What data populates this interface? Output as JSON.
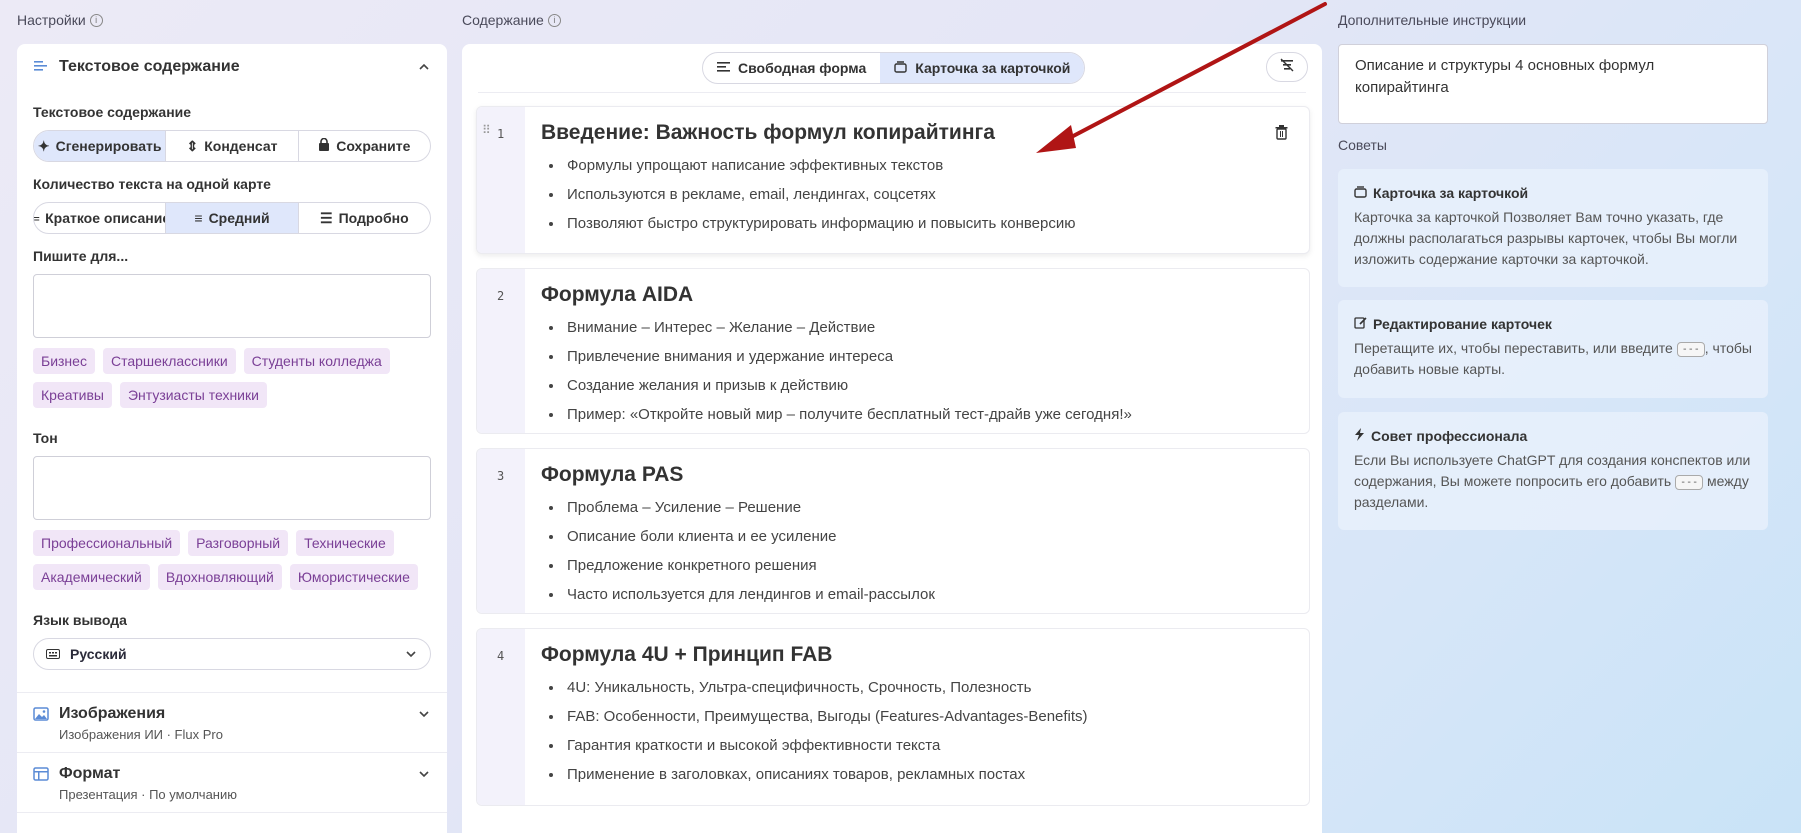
{
  "columns": {
    "settings": "Настройки",
    "content": "Содержание",
    "instructions": "Дополнительные инструкции",
    "tips": "Советы"
  },
  "left": {
    "text_section": {
      "title": "Текстовое содержание",
      "mode_label": "Текстовое содержание",
      "modes": [
        "Сгенерировать",
        "Конденсат",
        "Сохраните"
      ],
      "amount_label": "Количество текста на одной карте",
      "amounts": [
        "Краткое описание",
        "Средний",
        "Подробно"
      ],
      "write_for_label": "Пишите для...",
      "audience_chips": [
        "Бизнес",
        "Старшеклассники",
        "Студенты колледжа",
        "Креативы",
        "Энтузиасты техники"
      ],
      "tone_label": "Тон",
      "tone_chips": [
        "Профессиональный",
        "Разговорный",
        "Технические",
        "Академический",
        "Вдохновляющий",
        "Юмористические"
      ],
      "language_label": "Язык вывода",
      "language_value": "Русский"
    },
    "images_section": {
      "title": "Изображения",
      "sub": "Изображения ИИ · Flux Pro"
    },
    "format_section": {
      "title": "Формат",
      "sub": "Презентация · По умолчанию"
    }
  },
  "mid": {
    "toggle": [
      "Свободная форма",
      "Карточка за карточкой"
    ],
    "cards": [
      {
        "num": "1",
        "title": "Введение: Важность формул копирайтинга",
        "bullets": [
          "Формулы упрощают написание эффективных текстов",
          "Используются в рекламе, email, лендингах, соцсетях",
          "Позволяют быстро структурировать информацию и повысить конверсию"
        ]
      },
      {
        "num": "2",
        "title": "Формула AIDA",
        "bullets": [
          "Внимание – Интерес – Желание – Действие",
          "Привлечение внимания и удержание интереса",
          "Создание желания и призыв к действию",
          "Пример: «Откройте новый мир – получите бесплатный тест-драйв уже сегодня!»"
        ]
      },
      {
        "num": "3",
        "title": "Формула PAS",
        "bullets": [
          "Проблема – Усиление – Решение",
          "Описание боли клиента и ее усиление",
          "Предложение конкретного решения",
          "Часто используется для лендингов и email-рассылок"
        ]
      },
      {
        "num": "4",
        "title": "Формула 4U + Принцип FAB",
        "bullets": [
          "4U: Уникальность, Ультра-специфичность, Срочность, Полезность",
          "FAB: Особенности, Преимущества, Выгоды (Features-Advantages-Benefits)",
          "Гарантия краткости и высокой эффективности текста",
          "Применение в заголовках, описаниях товаров, рекламных постах"
        ]
      }
    ]
  },
  "right": {
    "instructions_value": "Описание и структуры 4 основных формул копирайтинга",
    "tips": [
      {
        "title": "Карточка за карточкой",
        "text": "Карточка за карточкой Позволяет Вам точно указать, где должны располагаться разрывы карточек, чтобы Вы могли изложить содержание карточки за карточкой."
      },
      {
        "title": "Редактирование карточек",
        "text_a": "Перетащите их, чтобы переставить, или введите",
        "kbd": "---",
        "text_b": ", чтобы добавить новые карты."
      },
      {
        "title": "Совет профессионала",
        "text_a": "Если Вы используете ChatGPT для создания конспектов или содержания, Вы можете попросить его добавить",
        "kbd": "---",
        "text_b": "между разделами."
      }
    ]
  },
  "colors": {
    "accent": "#dfe7fb",
    "chip_bg": "#f1e6f7",
    "chip_text": "#7a3f96",
    "arrow": "#b01515"
  }
}
